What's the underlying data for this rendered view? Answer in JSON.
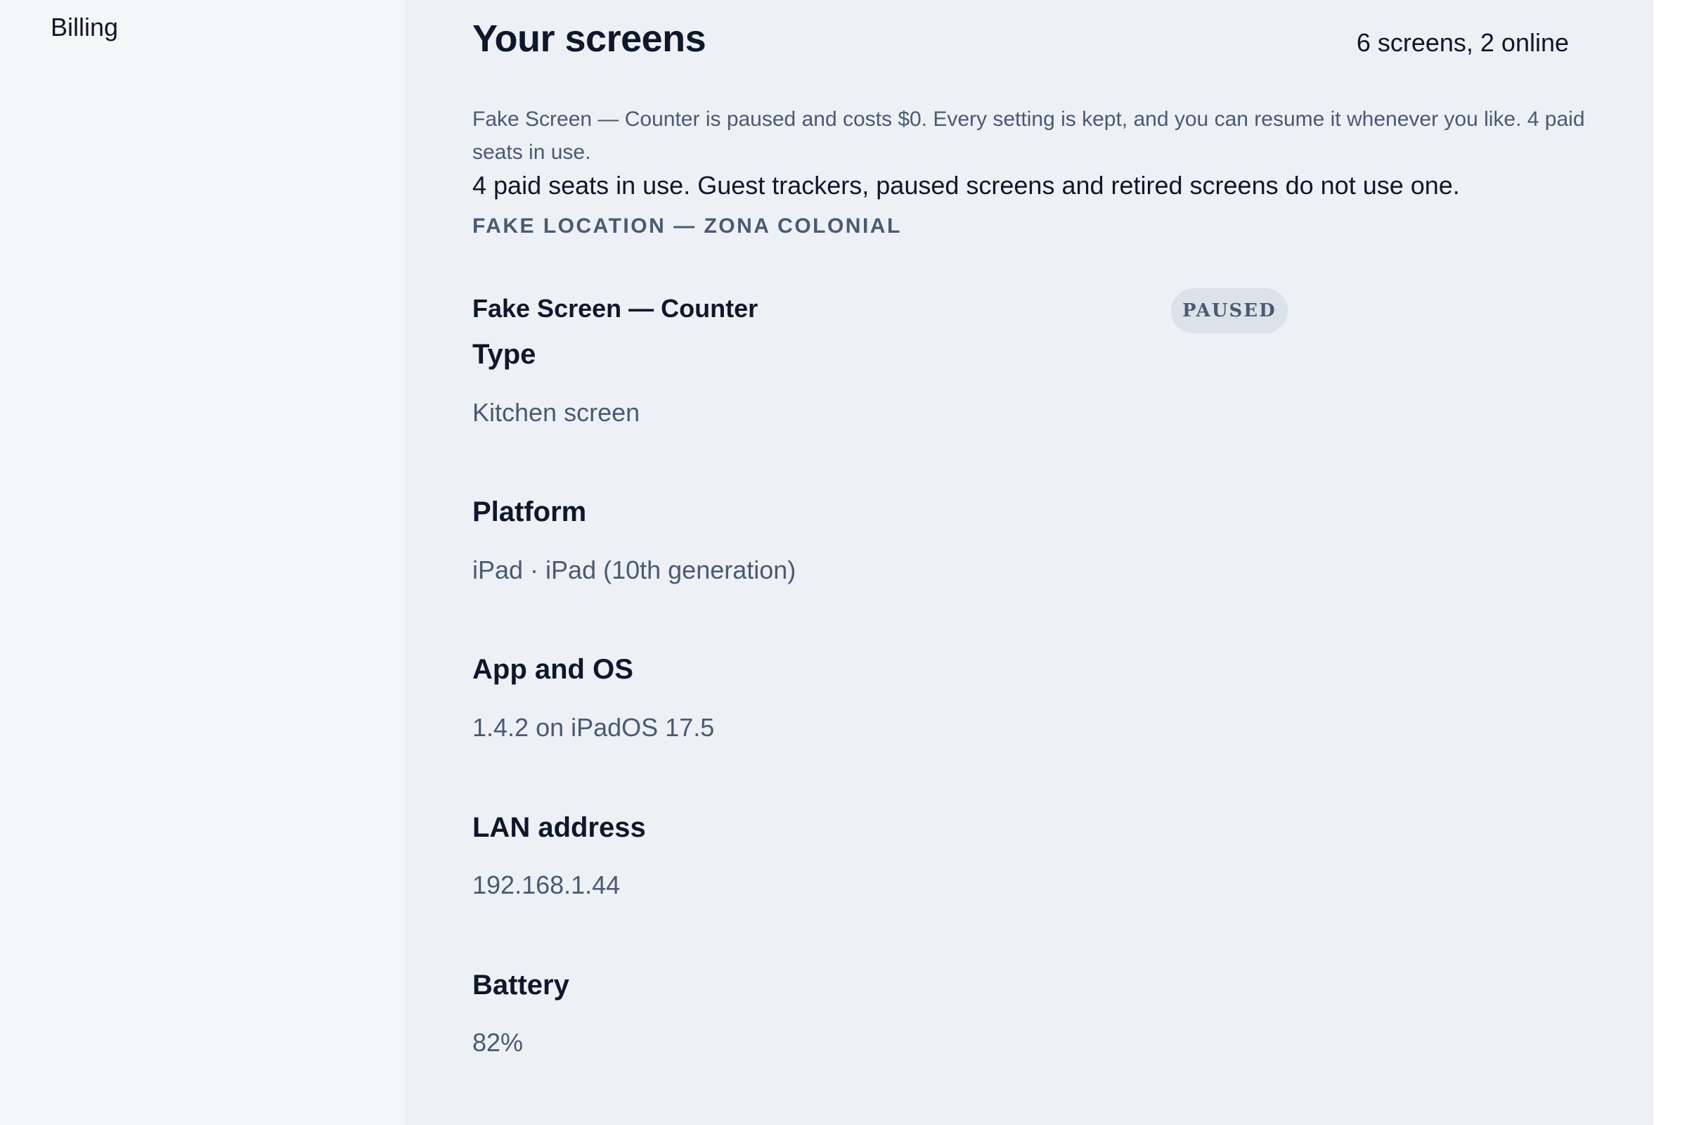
{
  "sidebar": {
    "items": [
      {
        "label": "Billing"
      }
    ]
  },
  "header": {
    "title": "Your screens",
    "summary": "6 screens, 2 online"
  },
  "notice": {
    "text": "Fake Screen — Counter is paused and costs $0. Every setting is kept, and you can resume it whenever you like. 4 paid seats in use."
  },
  "seats": {
    "text": "4 paid seats in use. Guest trackers, paused screens and retired screens do not use one."
  },
  "location": {
    "heading": "FAKE LOCATION — ZONA COLONIAL"
  },
  "screen": {
    "name": "Fake Screen — Counter",
    "status": "PAUSED",
    "fields": [
      {
        "label": "Type",
        "value": "Kitchen screen"
      },
      {
        "label": "Platform",
        "value": "iPad · iPad (10th generation)"
      },
      {
        "label": "App and OS",
        "value": "1.4.2 on iPadOS 17.5"
      },
      {
        "label": "LAN address",
        "value": "192.168.1.44"
      },
      {
        "label": "Battery",
        "value": "82%"
      }
    ]
  },
  "colors": {
    "sidebar_bg": "#f5f6f8",
    "main_bg": "#edf0f5",
    "text_primary": "#0f172a",
    "text_muted": "#4a5a70",
    "badge_bg": "#dbe2ea"
  }
}
